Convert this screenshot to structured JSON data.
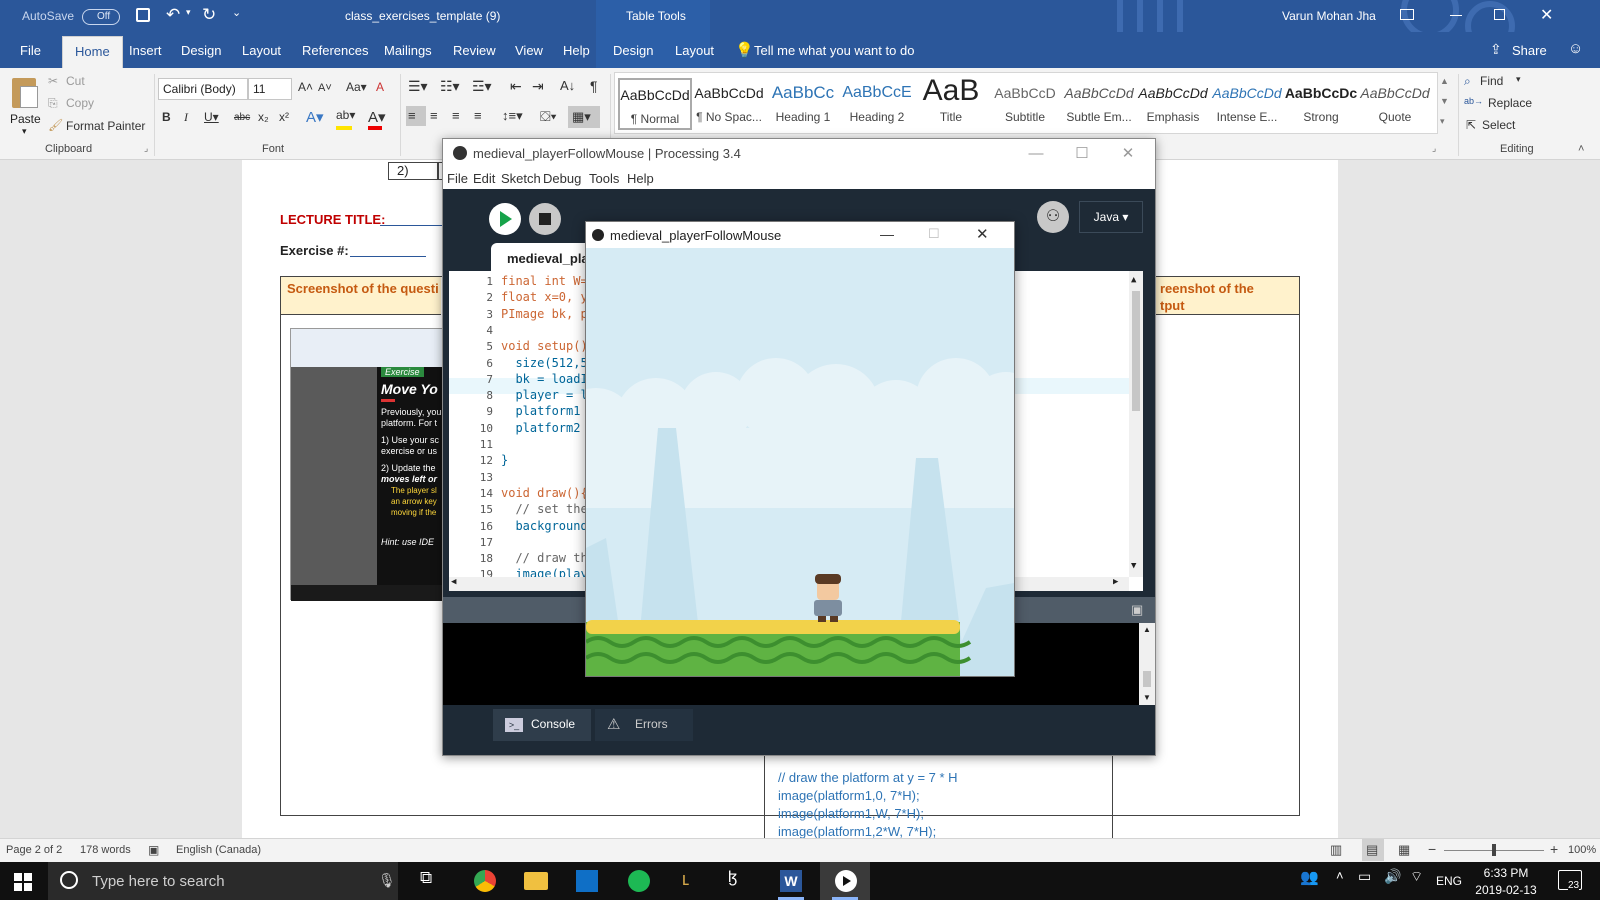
{
  "word": {
    "autosave_label": "AutoSave",
    "autosave_state": "Off",
    "doc_title": "class_exercises_template (9)",
    "contextual_group": "Table Tools",
    "user_name": "Varun Mohan Jha",
    "tabs": [
      "File",
      "Home",
      "Insert",
      "Design",
      "Layout",
      "References",
      "Mailings",
      "Review",
      "View",
      "Help"
    ],
    "ctx_tabs": [
      "Design",
      "Layout"
    ],
    "tell_me": "Tell me what you want to do",
    "share": "Share",
    "clipboard": {
      "paste": "Paste",
      "cut": "Cut",
      "copy": "Copy",
      "format_painter": "Format Painter",
      "group": "Clipboard"
    },
    "font": {
      "name": "Calibri (Body)",
      "size": "11",
      "group": "Font"
    },
    "styles": [
      {
        "preview": "AaBbCcDd",
        "name": "¶ Normal"
      },
      {
        "preview": "AaBbCcDd",
        "name": "¶ No Spac..."
      },
      {
        "preview": "AaBbCc",
        "name": "Heading 1"
      },
      {
        "preview": "AaBbCcE",
        "name": "Heading 2"
      },
      {
        "preview": "AaB",
        "name": "Title"
      },
      {
        "preview": "AaBbCcD",
        "name": "Subtitle"
      },
      {
        "preview": "AaBbCcDd",
        "name": "Subtle Em..."
      },
      {
        "preview": "AaBbCcDd",
        "name": "Emphasis"
      },
      {
        "preview": "AaBbCcDd",
        "name": "Intense E..."
      },
      {
        "preview": "AaBbCcDc",
        "name": "Strong"
      },
      {
        "preview": "AaBbCcDd",
        "name": "Quote"
      }
    ],
    "editing": {
      "find": "Find",
      "replace": "Replace",
      "select": "Select",
      "group": "Editing"
    },
    "doc": {
      "cell_num": "2)",
      "lecture_title": "LECTURE TITLE:",
      "exercise": "Exercise #:",
      "screenshot_q": "Screenshot of the questi",
      "screenshot_out_1": "reenshot of the",
      "screenshot_out_2": "tput",
      "mini_exercise": "Exercise",
      "mini_move": "Move Yo",
      "mini_text": [
        "Previously, you",
        "platform. For t",
        "1) Use your sc",
        "exercise or us",
        "2) Update the",
        "moves left or",
        "The player sl",
        "an arrow key",
        "moving if the",
        "Hint: use IDE"
      ],
      "code_lines": [
        "// draw the platform at y = 7 * H",
        "image(platform1,0, 7*H);",
        "image(platform1,W, 7*H);",
        "image(platform1,2*W, 7*H);"
      ]
    },
    "status": {
      "page": "Page 2 of 2",
      "words": "178 words",
      "language": "English (Canada)",
      "zoom": "100%"
    }
  },
  "processing": {
    "title": "medieval_playerFollowMouse | Processing 3.4",
    "menu": [
      "File",
      "Edit",
      "Sketch",
      "Debug",
      "Tools",
      "Help"
    ],
    "mode": "Java",
    "tab_name": "medieval_pla",
    "line_numbers": [
      "1",
      "2",
      "3",
      "4",
      "5",
      "6",
      "7",
      "8",
      "9",
      "10",
      "11",
      "12",
      "13",
      "14",
      "15",
      "16",
      "17",
      "18",
      "19"
    ],
    "code": [
      "final int W=",
      "float x=0, y",
      "PImage bk, p",
      "",
      "void setup()",
      "  size(512,5",
      "  bk = loadI",
      "  player = l",
      "  platform1 =",
      "  platform2 =",
      "",
      "}",
      "",
      "void draw(){",
      "  // set the",
      "  background",
      "",
      "  // draw the",
      "  image(playe"
    ],
    "console_tab": "Console",
    "errors_tab": "Errors"
  },
  "sketch": {
    "title": "medieval_playerFollowMouse"
  },
  "taskbar": {
    "search_placeholder": "Type here to search",
    "time": "6:33 PM",
    "date": "2019-02-13",
    "lang": "ENG",
    "notif_count": "23"
  }
}
